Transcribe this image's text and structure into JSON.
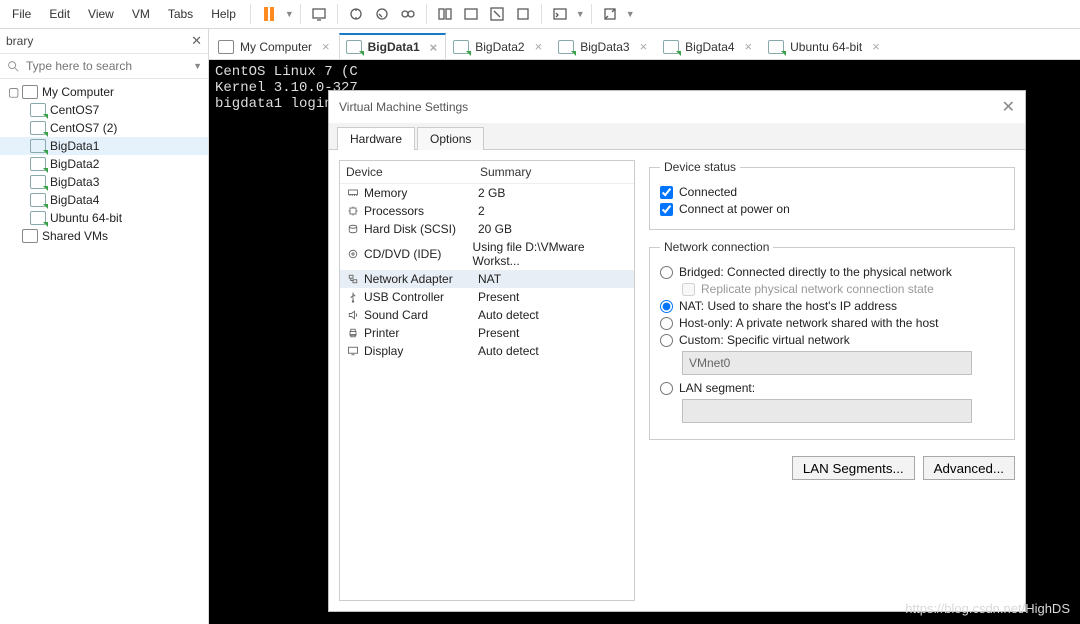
{
  "menu": {
    "items": [
      "File",
      "Edit",
      "View",
      "VM",
      "Tabs",
      "Help"
    ]
  },
  "sidebar": {
    "title": "brary",
    "search_placeholder": "Type here to search",
    "root": "My Computer",
    "vms": [
      "CentOS7",
      "CentOS7 (2)",
      "BigData1",
      "BigData2",
      "BigData3",
      "BigData4",
      "Ubuntu 64-bit"
    ],
    "shared": "Shared VMs",
    "selected_index": 2
  },
  "tabs": [
    {
      "label": "My Computer",
      "active": false
    },
    {
      "label": "BigData1",
      "active": true
    },
    {
      "label": "BigData2",
      "active": false
    },
    {
      "label": "BigData3",
      "active": false
    },
    {
      "label": "BigData4",
      "active": false
    },
    {
      "label": "Ubuntu 64-bit",
      "active": false
    }
  ],
  "console": {
    "lines": [
      "CentOS Linux 7 (C",
      "Kernel 3.10.0-327",
      "",
      "bigdata1 login: "
    ]
  },
  "dialog": {
    "title": "Virtual Machine Settings",
    "tabs": [
      "Hardware",
      "Options"
    ],
    "headers": {
      "device": "Device",
      "summary": "Summary"
    },
    "devices": [
      {
        "name": "Memory",
        "summary": "2 GB",
        "icon": "memory"
      },
      {
        "name": "Processors",
        "summary": "2",
        "icon": "cpu"
      },
      {
        "name": "Hard Disk (SCSI)",
        "summary": "20 GB",
        "icon": "disk"
      },
      {
        "name": "CD/DVD (IDE)",
        "summary": "Using file D:\\VMware Workst...",
        "icon": "cd"
      },
      {
        "name": "Network Adapter",
        "summary": "NAT",
        "icon": "net",
        "selected": true
      },
      {
        "name": "USB Controller",
        "summary": "Present",
        "icon": "usb"
      },
      {
        "name": "Sound Card",
        "summary": "Auto detect",
        "icon": "sound"
      },
      {
        "name": "Printer",
        "summary": "Present",
        "icon": "printer"
      },
      {
        "name": "Display",
        "summary": "Auto detect",
        "icon": "display"
      }
    ],
    "status": {
      "legend": "Device status",
      "connected": "Connected",
      "power_on": "Connect at power on"
    },
    "network": {
      "legend": "Network connection",
      "bridged": "Bridged: Connected directly to the physical network",
      "replicate": "Replicate physical network connection state",
      "nat": "NAT: Used to share the host's IP address",
      "hostonly": "Host-only: A private network shared with the host",
      "custom": "Custom: Specific virtual network",
      "custom_value": "VMnet0",
      "lanseg": "LAN segment:"
    },
    "buttons": {
      "lanseg": "LAN Segments...",
      "advanced": "Advanced..."
    }
  },
  "watermark": "https://blog.csdn.net/HighDS"
}
